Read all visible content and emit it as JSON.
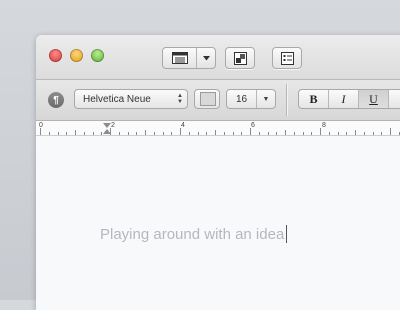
{
  "window": {
    "traffic_lights": {
      "close": "#d3342e",
      "minimize": "#db9b16",
      "zoom": "#58a83a"
    }
  },
  "toolbar": {
    "icons": [
      "layout-view-icon",
      "chevron-down-icon",
      "inspector-icon",
      "list-format-icon"
    ]
  },
  "format_bar": {
    "paragraph_icon_glyph": "¶",
    "font_family": "Helvetica Neue",
    "font_size": "16",
    "bold_label": "B",
    "italic_label": "I",
    "underline_label": "U"
  },
  "ruler": {
    "labels": [
      "0",
      "2",
      "4",
      "6",
      "8"
    ]
  },
  "document": {
    "text": "Playing around with an idea",
    "text_color": "#b4b8be"
  }
}
